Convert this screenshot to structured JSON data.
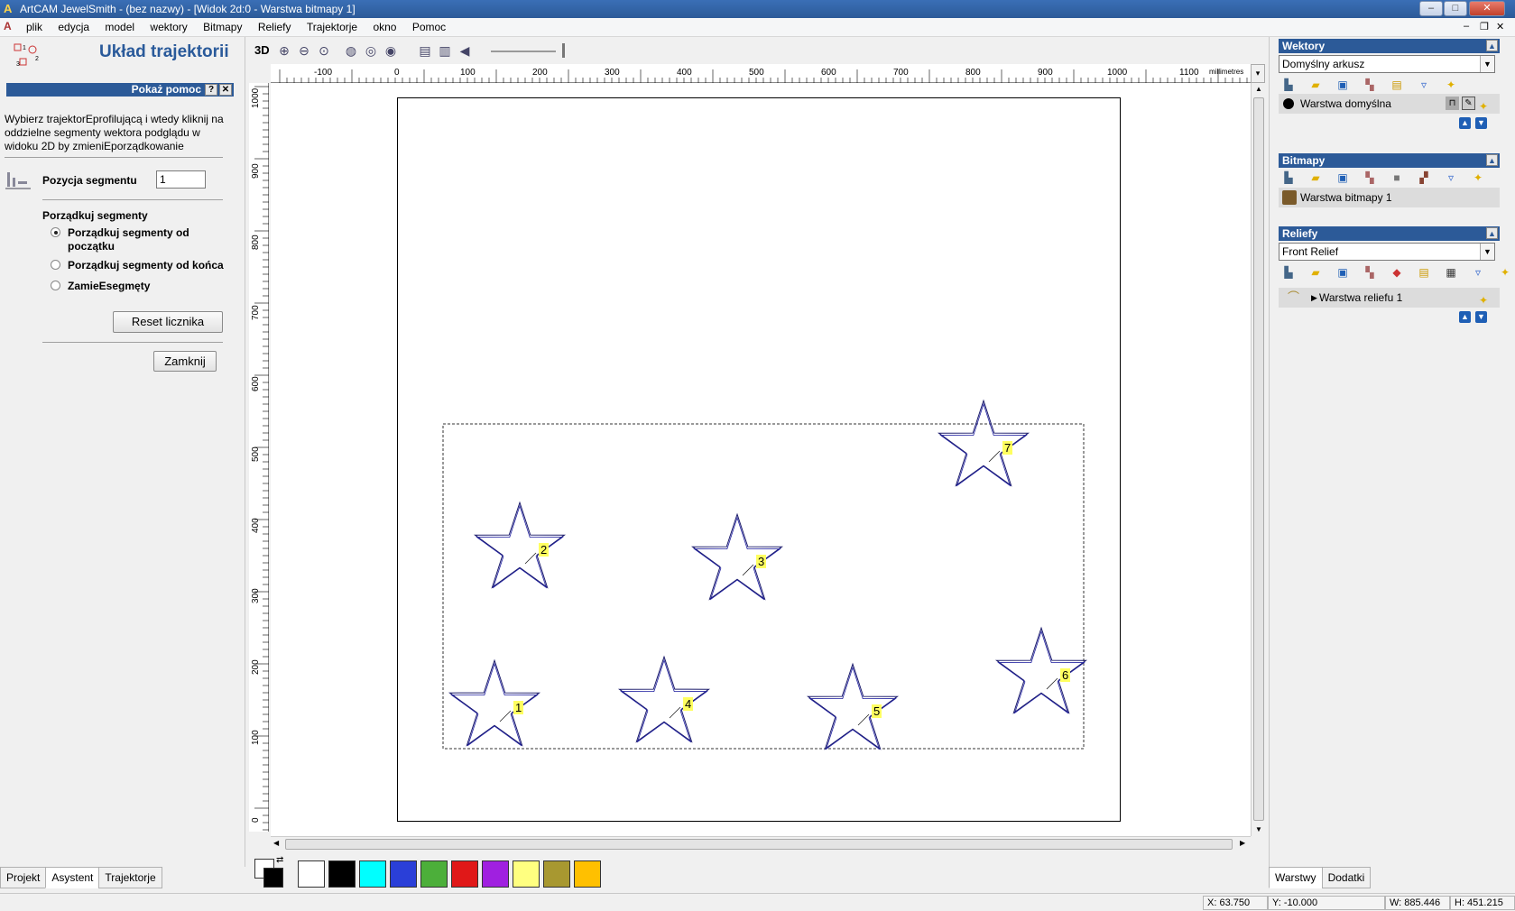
{
  "window": {
    "title": "ArtCAM JewelSmith - (bez nazwy) - [Widok 2d:0 - Warstwa bitmapy 1]",
    "min": "–",
    "max": "□",
    "close": "✕"
  },
  "menu": [
    "plik",
    "edycja",
    "model",
    "wektory",
    "Bitmapy",
    "Reliefy",
    "Trajektorje",
    "okno",
    "Pomoc"
  ],
  "left_panel": {
    "title": "Układ trajektorii",
    "help_bar": "Pokaż pomoc",
    "help_q": "?",
    "help_close": "✕",
    "help_text": "Wybierz trajektorEprofilującą i wtedy kliknij na oddzielne segmenty wektora podglądu w widoku 2D by zmieniEporządkowanie",
    "segment_position_label": "Pozycja segmentu",
    "segment_position_value": "1",
    "order_group_label": "Porządkuj segmenty",
    "options": [
      "Porządkuj segmenty od początku",
      "Porządkuj segmenty od końca",
      "ZamieEsegmęty"
    ],
    "selected_option": 0,
    "reset_button": "Reset licznika",
    "close_button": "Zamknij",
    "tabs": [
      "Projekt",
      "Asystent",
      "Trajektorje"
    ],
    "active_tab": 1
  },
  "toolbar": {
    "view_3d": "3D",
    "icons": [
      "zoom-in-icon",
      "zoom-out-icon",
      "zoom-fit-icon",
      "zoom-window-icon",
      "zoom-previous-icon",
      "zoom-all-icon",
      "toolpath-preview-icon",
      "toolpath-simulate-icon",
      "toolpath-reset-icon"
    ]
  },
  "ruler": {
    "units": "millimetres",
    "h_ticks": [
      "-100",
      "0",
      "100",
      "200",
      "300",
      "400",
      "500",
      "600",
      "700",
      "800",
      "900",
      "1000",
      "1100"
    ],
    "v_ticks": [
      "1000",
      "900",
      "800",
      "700",
      "600",
      "500",
      "400",
      "300",
      "200",
      "100",
      "0"
    ]
  },
  "stars": [
    {
      "label": "1"
    },
    {
      "label": "2"
    },
    {
      "label": "3"
    },
    {
      "label": "4"
    },
    {
      "label": "5"
    },
    {
      "label": "6"
    },
    {
      "label": "7"
    }
  ],
  "palette": {
    "colors": [
      "#ffffff",
      "#000000",
      "#00ffff",
      "#2a3fd8",
      "#4caf3a",
      "#e01818",
      "#a020e0",
      "#ffff80",
      "#a89830",
      "#ffc000"
    ]
  },
  "right_panel": {
    "vectors": {
      "header": "Wektory",
      "sheet": "Domyślny arkusz",
      "layer": "Warstwa domyślna"
    },
    "bitmaps": {
      "header": "Bitmapy",
      "layer": "Warstwa bitmapy 1"
    },
    "reliefs": {
      "header": "Reliefy",
      "relief": "Front Relief",
      "layer": "Warstwa reliefu 1"
    },
    "tabs": [
      "Warstwy",
      "Dodatki"
    ],
    "active_tab": 0
  },
  "status": {
    "x": "X: 63.750",
    "y": "Y: -10.000",
    "w": "W: 885.446",
    "h": "H: 451.215"
  }
}
